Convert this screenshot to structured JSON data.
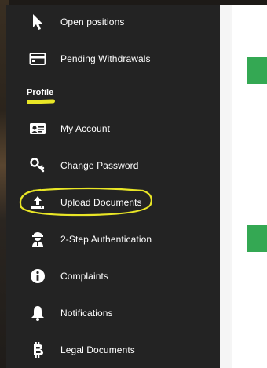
{
  "sidebar": {
    "section_title": "Profile",
    "items": [
      {
        "label": "Open positions",
        "icon": "cursor-icon"
      },
      {
        "label": "Pending Withdrawals",
        "icon": "card-icon"
      },
      {
        "label": "My Account",
        "icon": "id-card-icon"
      },
      {
        "label": "Change Password",
        "icon": "key-icon"
      },
      {
        "label": "Upload Documents",
        "icon": "upload-icon"
      },
      {
        "label": "2-Step Authentication",
        "icon": "user-secret-icon"
      },
      {
        "label": "Complaints",
        "icon": "info-icon"
      },
      {
        "label": "Notifications",
        "icon": "bell-icon"
      },
      {
        "label": "Legal Documents",
        "icon": "bitcoin-icon"
      }
    ]
  },
  "colors": {
    "sidebar_bg": "#232323",
    "text": "#ffffff",
    "accent_green": "#34a853",
    "highlight_yellow": "#e9e626"
  }
}
